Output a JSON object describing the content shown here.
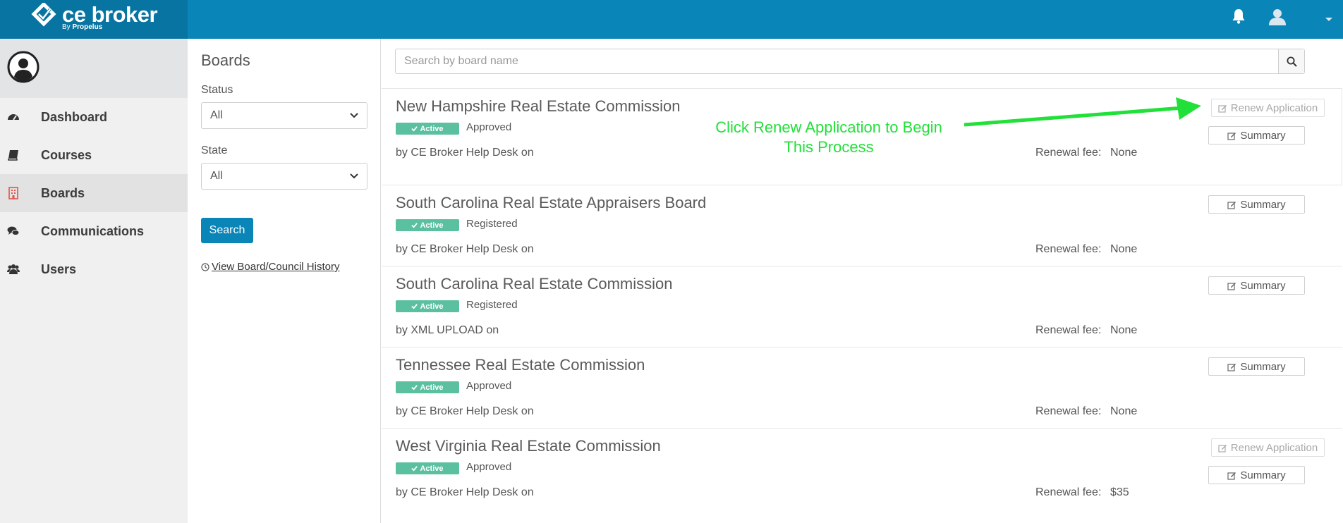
{
  "header": {
    "brand_name": "ce broker",
    "brand_by": "By",
    "brand_company": "Propelus"
  },
  "nav": {
    "items": [
      {
        "label": "Dashboard",
        "icon": "dashboard-icon"
      },
      {
        "label": "Courses",
        "icon": "book-icon"
      },
      {
        "label": "Boards",
        "icon": "board-icon"
      },
      {
        "label": "Communications",
        "icon": "comments-icon"
      },
      {
        "label": "Users",
        "icon": "users-icon"
      }
    ],
    "active": "Boards"
  },
  "filters": {
    "title": "Boards",
    "status_label": "Status",
    "status_value": "All",
    "state_label": "State",
    "state_value": "All",
    "search_button": "Search",
    "history_link": "View Board/Council History"
  },
  "search": {
    "placeholder": "Search by board name"
  },
  "boards": [
    {
      "name": "New Hampshire Real Estate Commission",
      "badge": "Active",
      "status": "Approved",
      "by": "by CE Broker Help Desk on",
      "fee_label": "Renewal fee:",
      "fee": "None",
      "renew": "Renew Application",
      "summary": "Summary"
    },
    {
      "name": "South Carolina Real Estate Appraisers Board",
      "badge": "Active",
      "status": "Registered",
      "by": "by CE Broker Help Desk on",
      "fee_label": "Renewal fee:",
      "fee": "None",
      "summary": "Summary"
    },
    {
      "name": "South Carolina Real Estate Commission",
      "badge": "Active",
      "status": "Registered",
      "by": "by XML UPLOAD on",
      "fee_label": "Renewal fee:",
      "fee": "None",
      "summary": "Summary"
    },
    {
      "name": "Tennessee Real Estate Commission",
      "badge": "Active",
      "status": "Approved",
      "by": "by CE Broker Help Desk on",
      "fee_label": "Renewal fee:",
      "fee": "None",
      "summary": "Summary"
    },
    {
      "name": "West Virginia Real Estate Commission",
      "badge": "Active",
      "status": "Approved",
      "by": "by CE Broker Help Desk on",
      "fee_label": "Renewal fee:",
      "fee": "$35",
      "renew": "Renew Application",
      "summary": "Summary"
    }
  ],
  "annotation": {
    "line1": "Click Renew Application to Begin",
    "line2": "This Process",
    "color": "#22e03a"
  },
  "colors": {
    "header": "#0a85b8",
    "brand_bg": "#0874a1",
    "badge": "#5bc0a0",
    "accent": "#0a85b8"
  }
}
